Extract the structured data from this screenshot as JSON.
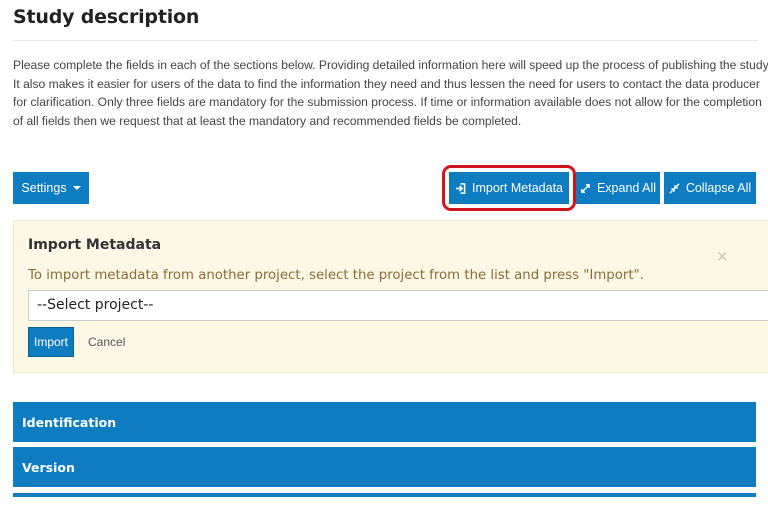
{
  "page": {
    "title": "Study description",
    "intro_lines": [
      "Please complete the fields in each of the sections below. Providing detailed information here will speed up the process of publishing the study.",
      "It also makes it easier for users of the data to find the information they need and thus lessen the need for users to contact the data producer",
      "for clarification. Only three fields are mandatory for the submission process. If time or information available does not allow for the completion",
      "of all fields then we request that at least the mandatory and recommended fields be completed."
    ]
  },
  "toolbar": {
    "settings_label": "Settings",
    "import_metadata_label": "Import Metadata",
    "expand_all_label": "Expand All",
    "collapse_all_label": "Collapse All"
  },
  "import_panel": {
    "title": "Import Metadata",
    "close_symbol": "×",
    "hint": "To import metadata from another project, select the project from the list and press \"Import\".",
    "select_value": "--Select project--",
    "import_label": "Import",
    "cancel_label": "Cancel"
  },
  "sections": [
    {
      "label": "Identification"
    },
    {
      "label": "Version"
    }
  ],
  "colors": {
    "accent": "#0d7cc1",
    "highlight": "#d3131c",
    "panel_bg": "#fcf8e5"
  }
}
